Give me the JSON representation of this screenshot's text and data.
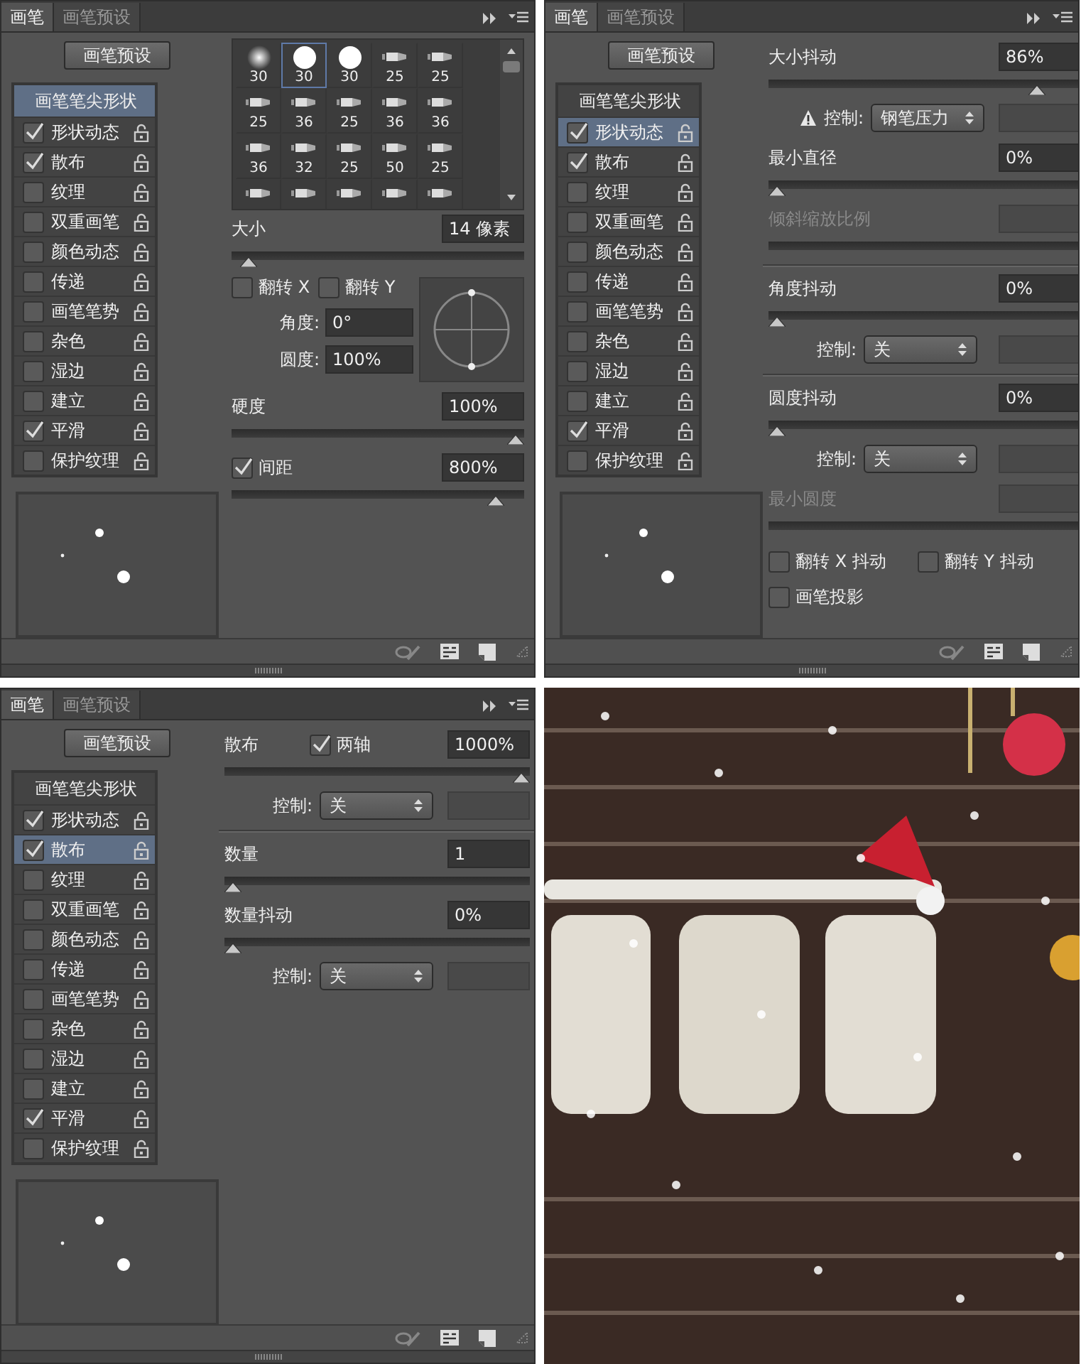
{
  "panels": [
    {
      "tabs": [
        {
          "label": "画笔",
          "selected": true
        },
        {
          "label": "画笔预设",
          "selected": false
        }
      ],
      "preset_button": "画笔预设",
      "options": [
        {
          "kind": "header",
          "label": "画笔笔尖形状",
          "selected": true
        },
        {
          "kind": "option",
          "label": "形状动态",
          "checked": true,
          "selected": false
        },
        {
          "kind": "option",
          "label": "散布",
          "checked": true,
          "selected": false
        },
        {
          "kind": "option",
          "label": "纹理",
          "checked": false,
          "selected": false
        },
        {
          "kind": "option",
          "label": "双重画笔",
          "checked": false,
          "selected": false
        },
        {
          "kind": "option",
          "label": "颜色动态",
          "checked": false,
          "selected": false
        },
        {
          "kind": "option",
          "label": "传递",
          "checked": false,
          "selected": false
        },
        {
          "kind": "option",
          "label": "画笔笔势",
          "checked": false,
          "selected": false
        },
        {
          "kind": "option",
          "label": "杂色",
          "checked": false,
          "selected": false
        },
        {
          "kind": "option",
          "label": "湿边",
          "checked": false,
          "selected": false
        },
        {
          "kind": "option",
          "label": "建立",
          "checked": false,
          "selected": false
        },
        {
          "kind": "option",
          "label": "平滑",
          "checked": true,
          "selected": false
        },
        {
          "kind": "option",
          "label": "保护纹理",
          "checked": false,
          "selected": false
        }
      ],
      "settings": [
        {
          "kind": "brush_grid",
          "tips": [
            {
              "size": "30",
              "selected": false
            },
            {
              "size": "30",
              "selected": true
            },
            {
              "size": "30",
              "selected": false
            },
            {
              "size": "25",
              "selected": false
            },
            {
              "size": "25",
              "selected": false
            },
            {
              "size": "25",
              "selected": false
            },
            {
              "size": "36",
              "selected": false
            },
            {
              "size": "25",
              "selected": false
            },
            {
              "size": "36",
              "selected": false
            },
            {
              "size": "36",
              "selected": false
            },
            {
              "size": "36",
              "selected": false
            },
            {
              "size": "32",
              "selected": false
            },
            {
              "size": "25",
              "selected": false
            },
            {
              "size": "50",
              "selected": false
            },
            {
              "size": "25",
              "selected": false
            },
            {
              "selected": false
            },
            {
              "selected": false
            },
            {
              "selected": false
            },
            {
              "selected": false
            },
            {
              "selected": false
            }
          ]
        },
        {
          "kind": "field",
          "label": "大小",
          "value": "14 像素"
        },
        {
          "kind": "slider",
          "level": 0.03
        },
        {
          "kind": "tip_shape",
          "flips": [
            {
              "label": "翻转 X",
              "checked": false
            },
            {
              "label": "翻转 Y",
              "checked": false
            }
          ],
          "fields": [
            {
              "label": "角度:",
              "value": "0°"
            },
            {
              "label": "圆度:",
              "value": "100%"
            }
          ]
        },
        {
          "kind": "field",
          "label": "硬度",
          "value": "100%"
        },
        {
          "kind": "slider",
          "level": 1.0
        },
        {
          "kind": "field",
          "check": {
            "label": "间距",
            "checked": true
          },
          "value": "800%"
        },
        {
          "kind": "slider",
          "level": 0.93
        }
      ]
    },
    {
      "tabs": [
        {
          "label": "画笔",
          "selected": true
        },
        {
          "label": "画笔预设",
          "selected": false
        }
      ],
      "preset_button": "画笔预设",
      "options": [
        {
          "kind": "header",
          "label": "画笔笔尖形状",
          "selected": false
        },
        {
          "kind": "option",
          "label": "形状动态",
          "checked": true,
          "selected": true
        },
        {
          "kind": "option",
          "label": "散布",
          "checked": true,
          "selected": false
        },
        {
          "kind": "option",
          "label": "纹理",
          "checked": false,
          "selected": false
        },
        {
          "kind": "option",
          "label": "双重画笔",
          "checked": false,
          "selected": false
        },
        {
          "kind": "option",
          "label": "颜色动态",
          "checked": false,
          "selected": false
        },
        {
          "kind": "option",
          "label": "传递",
          "checked": false,
          "selected": false
        },
        {
          "kind": "option",
          "label": "画笔笔势",
          "checked": false,
          "selected": false
        },
        {
          "kind": "option",
          "label": "杂色",
          "checked": false,
          "selected": false
        },
        {
          "kind": "option",
          "label": "湿边",
          "checked": false,
          "selected": false
        },
        {
          "kind": "option",
          "label": "建立",
          "checked": false,
          "selected": false
        },
        {
          "kind": "option",
          "label": "平滑",
          "checked": true,
          "selected": false
        },
        {
          "kind": "option",
          "label": "保护纹理",
          "checked": false,
          "selected": false
        }
      ],
      "settings": [
        {
          "kind": "field",
          "label": "大小抖动",
          "value": "86%"
        },
        {
          "kind": "slider",
          "level": 0.88
        },
        {
          "kind": "control",
          "warning": true,
          "label": "控制:",
          "value": "钢笔压力"
        },
        {
          "kind": "field",
          "label": "最小直径",
          "value": "0%"
        },
        {
          "kind": "slider",
          "level": 0
        },
        {
          "kind": "field",
          "label": "倾斜缩放比例",
          "disabled": true
        },
        {
          "kind": "track"
        },
        {
          "kind": "divider"
        },
        {
          "kind": "field",
          "label": "角度抖动",
          "value": "0%"
        },
        {
          "kind": "slider",
          "level": 0
        },
        {
          "kind": "control",
          "warning": false,
          "label": "控制:",
          "value": "关"
        },
        {
          "kind": "divider"
        },
        {
          "kind": "field",
          "label": "圆度抖动",
          "value": "0%"
        },
        {
          "kind": "slider",
          "level": 0
        },
        {
          "kind": "control",
          "warning": false,
          "label": "控制:",
          "value": "关"
        },
        {
          "kind": "field",
          "label": "最小圆度",
          "disabled": true
        },
        {
          "kind": "track"
        },
        {
          "kind": "checks",
          "items": [
            {
              "label": "翻转 X 抖动",
              "checked": false
            },
            {
              "label": "翻转 Y 抖动",
              "checked": false
            }
          ]
        },
        {
          "kind": "checks",
          "items": [
            {
              "label": "画笔投影",
              "checked": false
            }
          ]
        }
      ]
    },
    {
      "tabs": [
        {
          "label": "画笔",
          "selected": true
        },
        {
          "label": "画笔预设",
          "selected": false
        }
      ],
      "preset_button": "画笔预设",
      "options": [
        {
          "kind": "header",
          "label": "画笔笔尖形状",
          "selected": false
        },
        {
          "kind": "option",
          "label": "形状动态",
          "checked": true,
          "selected": false
        },
        {
          "kind": "option",
          "label": "散布",
          "checked": true,
          "selected": true
        },
        {
          "kind": "option",
          "label": "纹理",
          "checked": false,
          "selected": false
        },
        {
          "kind": "option",
          "label": "双重画笔",
          "checked": false,
          "selected": false
        },
        {
          "kind": "option",
          "label": "颜色动态",
          "checked": false,
          "selected": false
        },
        {
          "kind": "option",
          "label": "传递",
          "checked": false,
          "selected": false
        },
        {
          "kind": "option",
          "label": "画笔笔势",
          "checked": false,
          "selected": false
        },
        {
          "kind": "option",
          "label": "杂色",
          "checked": false,
          "selected": false
        },
        {
          "kind": "option",
          "label": "湿边",
          "checked": false,
          "selected": false
        },
        {
          "kind": "option",
          "label": "建立",
          "checked": false,
          "selected": false
        },
        {
          "kind": "option",
          "label": "平滑",
          "checked": true,
          "selected": false
        },
        {
          "kind": "option",
          "label": "保护纹理",
          "checked": false,
          "selected": false
        }
      ],
      "settings": [
        {
          "kind": "field",
          "label": "散布",
          "check": {
            "label": "两轴",
            "checked": true
          },
          "value": "1000%"
        },
        {
          "kind": "slider",
          "level": 1.0
        },
        {
          "kind": "control",
          "warning": false,
          "label": "控制:",
          "value": "关"
        },
        {
          "kind": "divider"
        },
        {
          "kind": "field",
          "label": "数量",
          "value": "1"
        },
        {
          "kind": "slider",
          "level": 0
        },
        {
          "kind": "field",
          "label": "数量抖动",
          "value": "0%"
        },
        {
          "kind": "slider",
          "level": 0
        },
        {
          "kind": "control",
          "warning": false,
          "label": "控制:",
          "value": "关"
        }
      ]
    }
  ]
}
